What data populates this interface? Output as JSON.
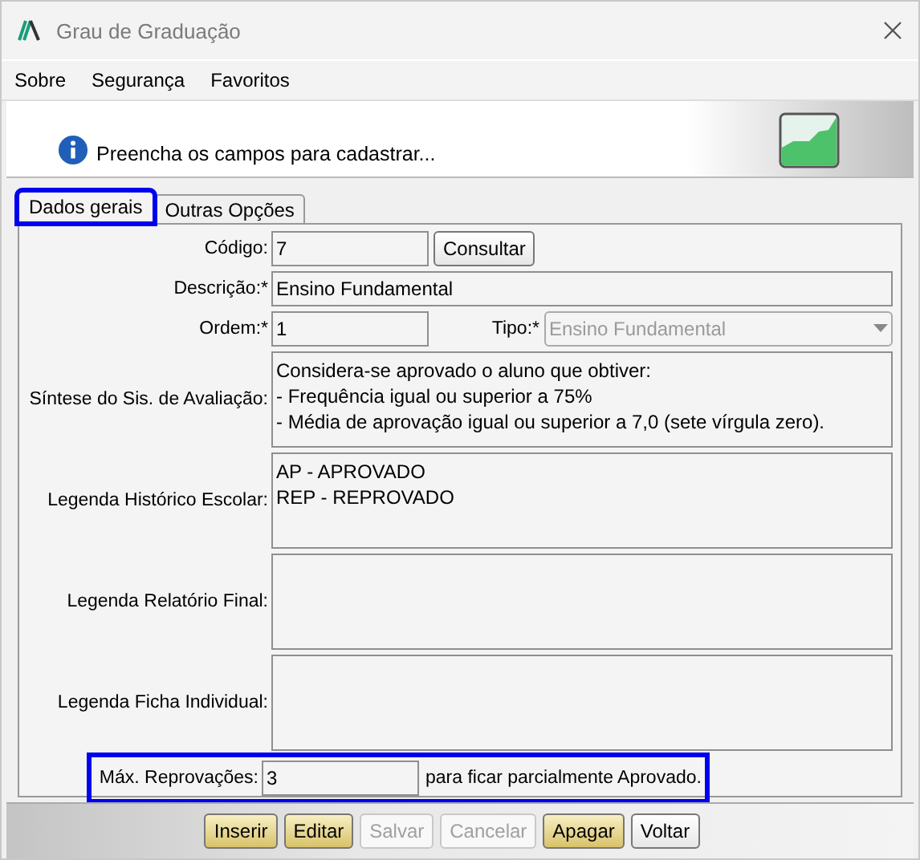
{
  "window": {
    "title": "Grau de Graduação"
  },
  "menu": [
    "Sobre",
    "Segurança",
    "Favoritos"
  ],
  "banner": {
    "message": "Preencha os campos para cadastrar..."
  },
  "tabs": [
    {
      "label": "Dados gerais",
      "selected": true,
      "highlighted": true
    },
    {
      "label": "Outras Opções",
      "selected": false,
      "highlighted": false
    }
  ],
  "form": {
    "codigo": {
      "label": "Código:",
      "value": "7",
      "button": "Consultar"
    },
    "descricao": {
      "label": "Descrição:*",
      "value": "Ensino Fundamental"
    },
    "ordem": {
      "label": "Ordem:*",
      "value": "1"
    },
    "tipo": {
      "label": "Tipo:*",
      "value": "Ensino Fundamental",
      "disabled": true
    },
    "areas": [
      {
        "label": "Síntese do Sis. de Avaliação:",
        "lines": [
          "Considera-se aprovado o aluno que obtiver:",
          "- Frequência igual ou superior a 75%",
          "- Média de aprovação igual ou superior a 7,0 (sete vírgula zero)."
        ]
      },
      {
        "label": "Legenda Histórico Escolar:",
        "lines": [
          "AP - APROVADO",
          "REP - REPROVADO"
        ]
      },
      {
        "label": "Legenda Relatório Final:"
      },
      {
        "label": "Legenda Ficha Individual:"
      }
    ],
    "max": {
      "label": "Máx. Reprovações:",
      "value": "3",
      "suffix": "para ficar parcialmente Aprovado.",
      "highlighted": true
    }
  },
  "buttons": [
    {
      "label": "Inserir",
      "kind": "accent",
      "disabled": false
    },
    {
      "label": "Editar",
      "kind": "accent",
      "disabled": false
    },
    {
      "label": "Salvar",
      "kind": "plain",
      "disabled": true
    },
    {
      "label": "Cancelar",
      "kind": "plain",
      "disabled": true
    },
    {
      "label": "Apagar",
      "kind": "accent",
      "disabled": false
    },
    {
      "label": "Voltar",
      "kind": "plain",
      "disabled": false
    }
  ]
}
